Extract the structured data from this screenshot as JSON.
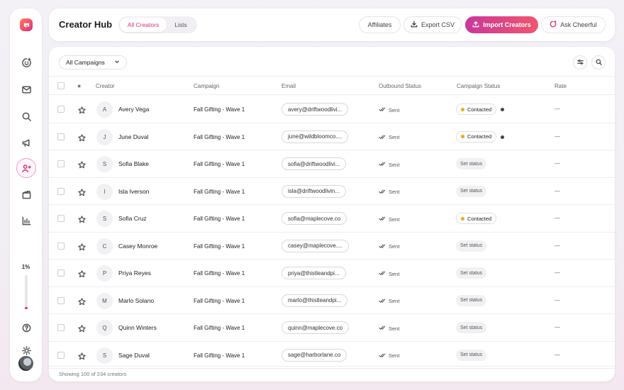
{
  "sidebar": {
    "usage_label": "1%",
    "usage_fraction": 0.01,
    "icons": [
      "smile-chat-icon",
      "mail-icon",
      "search-icon",
      "megaphone-icon",
      "users-icon",
      "clapperboard-icon",
      "bar-chart-icon"
    ],
    "bottom_icons": [
      "help-icon",
      "sun-icon"
    ]
  },
  "header": {
    "title": "Creator Hub",
    "tabs": [
      {
        "label": "All Creators"
      },
      {
        "label": "Lists"
      }
    ],
    "affiliates": "Affiliates",
    "export_csv": "Export CSV",
    "import_creators": "Import Creators",
    "ask": "Ask Cheerful"
  },
  "toolbar": {
    "campaign_filter": "All Campaigns"
  },
  "table": {
    "columns": {
      "star": "★",
      "creator": "Creator",
      "campaign": "Campaign",
      "email": "Email",
      "outbound": "Outbound Status",
      "campaign_status": "Campaign Status",
      "rate": "Rate"
    },
    "rows": [
      {
        "initial": "A",
        "name": "Avery Vega",
        "campaign": "Fall Gifting - Wave 1",
        "email": "avery@driftwoodlivi...",
        "outbound": "Sent",
        "status": "Contacted",
        "status_type": "contacted",
        "dot": true,
        "rate": "—"
      },
      {
        "initial": "J",
        "name": "June Duval",
        "campaign": "Fall Gifting - Wave 1",
        "email": "june@wildbloomco....",
        "outbound": "Sent",
        "status": "Contacted",
        "status_type": "contacted",
        "dot": true,
        "rate": "—"
      },
      {
        "initial": "S",
        "name": "Sofia Blake",
        "campaign": "Fall Gifting - Wave 1",
        "email": "sofia@driftwoodlivi...",
        "outbound": "Sent",
        "status": "Set status",
        "status_type": "unset",
        "dot": false,
        "rate": "—"
      },
      {
        "initial": "I",
        "name": "Isla Iverson",
        "campaign": "Fall Gifting - Wave 1",
        "email": "isla@driftwoodlivin...",
        "outbound": "Sent",
        "status": "Set status",
        "status_type": "unset",
        "dot": false,
        "rate": "—"
      },
      {
        "initial": "S",
        "name": "Sofia Cruz",
        "campaign": "Fall Gifting - Wave 1",
        "email": "sofia@maplecove.co",
        "outbound": "Sent",
        "status": "Contacted",
        "status_type": "contacted",
        "dot": false,
        "rate": "—"
      },
      {
        "initial": "C",
        "name": "Casey Monroe",
        "campaign": "Fall Gifting - Wave 1",
        "email": "casey@maplecove....",
        "outbound": "Sent",
        "status": "Set status",
        "status_type": "unset",
        "dot": false,
        "rate": "—"
      },
      {
        "initial": "P",
        "name": "Priya Reyes",
        "campaign": "Fall Gifting - Wave 1",
        "email": "priya@thistleandpi...",
        "outbound": "Sent",
        "status": "Set status",
        "status_type": "unset",
        "dot": false,
        "rate": "—"
      },
      {
        "initial": "M",
        "name": "Marlo Solano",
        "campaign": "Fall Gifting - Wave 1",
        "email": "marlo@thistleandpi...",
        "outbound": "Sent",
        "status": "Set status",
        "status_type": "unset",
        "dot": false,
        "rate": "—"
      },
      {
        "initial": "Q",
        "name": "Quinn Winters",
        "campaign": "Fall Gifting - Wave 1",
        "email": "quinn@maplecove.co",
        "outbound": "Sent",
        "status": "Set status",
        "status_type": "unset",
        "dot": false,
        "rate": "—"
      },
      {
        "initial": "S",
        "name": "Sage Duval",
        "campaign": "Fall Gifting - Wave 1",
        "email": "sage@harborlane.co",
        "outbound": "Sent",
        "status": "Set status",
        "status_type": "unset",
        "dot": false,
        "rate": "—"
      }
    ]
  },
  "footer": {
    "summary": "Showing 100 of 234 creators"
  },
  "colors": {
    "accent": "#d5337a",
    "primary_gradient_start": "#c9379a",
    "primary_gradient_end": "#f0566e",
    "contacted_dot": "#f2a619"
  }
}
